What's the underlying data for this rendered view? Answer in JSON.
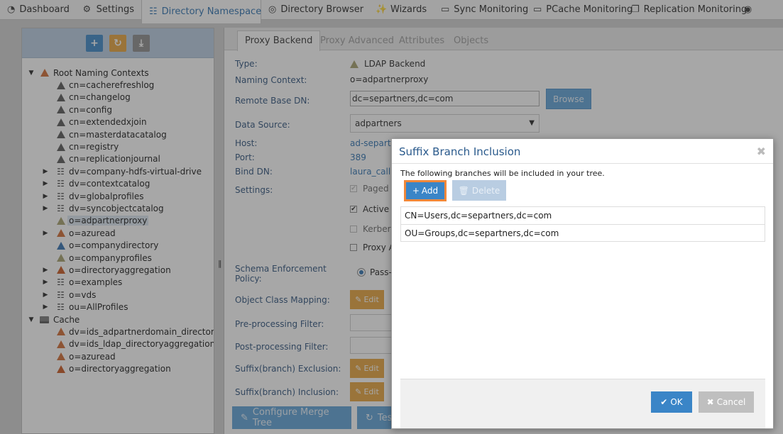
{
  "top_nav": {
    "tabs": [
      {
        "label": "Dashboard",
        "icon": "dashboard-icon",
        "glyph": "◔"
      },
      {
        "label": "Settings",
        "icon": "gears-icon",
        "glyph": "⚙"
      },
      {
        "label": "Directory Namespace",
        "icon": "sitemap-icon",
        "glyph": "☷",
        "active": true
      },
      {
        "label": "Directory Browser",
        "icon": "globe-icon",
        "glyph": "◎"
      },
      {
        "label": "Wizards",
        "icon": "magic-wand-icon",
        "glyph": "✨"
      },
      {
        "label": "Sync Monitoring",
        "icon": "monitor-icon",
        "glyph": "▭"
      },
      {
        "label": "PCache Monitoring",
        "icon": "monitor-icon",
        "glyph": "▭"
      },
      {
        "label": "Replication Monitoring",
        "icon": "copy-icon",
        "glyph": "❐"
      },
      {
        "label": "",
        "icon": "eye-icon",
        "glyph": "◉"
      }
    ]
  },
  "left_toolbar": {
    "add": "+",
    "refresh": "↻",
    "download": "⤓"
  },
  "tree": {
    "root_label": "Root Naming Contexts",
    "items": [
      {
        "label": "cn=cacherefreshlog",
        "icon": "tri-dark",
        "toggle": ""
      },
      {
        "label": "cn=changelog",
        "icon": "tri-dark",
        "toggle": ""
      },
      {
        "label": "cn=config",
        "icon": "tri-dark",
        "toggle": ""
      },
      {
        "label": "cn=extendedxjoin",
        "icon": "tri-dark",
        "toggle": ""
      },
      {
        "label": "cn=masterdatacatalog",
        "icon": "tri-dark",
        "toggle": ""
      },
      {
        "label": "cn=registry",
        "icon": "tri-dark",
        "toggle": ""
      },
      {
        "label": "cn=replicationjournal",
        "icon": "tri-dark",
        "toggle": ""
      },
      {
        "label": "dv=company-hdfs-virtual-drive",
        "icon": "org",
        "toggle": "▶"
      },
      {
        "label": "dv=contextcatalog",
        "icon": "org",
        "toggle": "▶"
      },
      {
        "label": "dv=globalprofiles",
        "icon": "org",
        "toggle": "▶"
      },
      {
        "label": "dv=syncobjectcatalog",
        "icon": "org",
        "toggle": "▶"
      },
      {
        "label": "o=adpartnerproxy",
        "icon": "tri-olive",
        "toggle": "",
        "selected": true
      },
      {
        "label": "o=azuread",
        "icon": "tri-orange",
        "toggle": "▶"
      },
      {
        "label": "o=companydirectory",
        "icon": "tri-blue",
        "toggle": ""
      },
      {
        "label": "o=companyprofiles",
        "icon": "tri-olive",
        "toggle": ""
      },
      {
        "label": "o=directoryaggregation",
        "icon": "tri-multi",
        "toggle": "▶"
      },
      {
        "label": "o=examples",
        "icon": "org",
        "toggle": "▶"
      },
      {
        "label": "o=vds",
        "icon": "org",
        "toggle": "▶"
      },
      {
        "label": "ou=AllProfiles",
        "icon": "org",
        "toggle": "▶"
      }
    ],
    "cache_label": "Cache",
    "cache_items": [
      {
        "label": "dv=ids_adpartnerdomain_directoryag",
        "icon": "tri-orange"
      },
      {
        "label": "dv=ids_ldap_directoryaggregation,dv",
        "icon": "tri-orange"
      },
      {
        "label": "o=azuread",
        "icon": "tri-orange"
      },
      {
        "label": "o=directoryaggregation",
        "icon": "tri-multi"
      }
    ]
  },
  "subtabs": [
    "Proxy Backend",
    "Proxy Advanced",
    "Attributes",
    "Objects"
  ],
  "form": {
    "type_label": "Type:",
    "type_value": "LDAP Backend",
    "naming_context_label": "Naming Context:",
    "naming_context_value": "o=adpartnerproxy",
    "remote_base_dn_label": "Remote Base DN:",
    "remote_base_dn_value": "dc=separtners,dc=com",
    "browse_label": "Browse",
    "data_source_label": "Data Source:",
    "data_source_value": "adpartners",
    "host_label": "Host:",
    "host_value": "ad-separtr",
    "port_label": "Port:",
    "port_value": "389",
    "bind_dn_label": "Bind DN:",
    "bind_dn_value": "laura_calla",
    "settings_label": "Settings:",
    "settings": [
      {
        "label": "Paged F",
        "checked": true,
        "dim": true
      },
      {
        "label": "Active",
        "checked": true,
        "dim": false
      },
      {
        "label": "Kerbero",
        "checked": false,
        "dim": true
      },
      {
        "label": "Proxy A",
        "checked": false,
        "dim": false
      }
    ],
    "schema_label_line1": "Schema Enforcement",
    "schema_label_line2": "Policy:",
    "schema_value": "Pass-",
    "object_class_label": "Object Class Mapping:",
    "pre_filter_label": "Pre-processing Filter:",
    "post_filter_label": "Post-processing Filter:",
    "suffix_exclusion_label": "Suffix(branch) Exclusion:",
    "suffix_inclusion_label": "Suffix(branch) Inclusion:",
    "edit_label": "Edit",
    "configure_merge_label": "Configure Merge Tree",
    "test_label": "Tes"
  },
  "modal": {
    "title": "Suffix Branch Inclusion",
    "close": "✖",
    "description": "The following branches will be included in your tree.",
    "add_label": "Add",
    "delete_label": "Delete",
    "branches": [
      "CN=Users,dc=separtners,dc=com",
      "OU=Groups,dc=separtners,dc=com"
    ],
    "ok_label": "OK",
    "cancel_label": "Cancel"
  }
}
